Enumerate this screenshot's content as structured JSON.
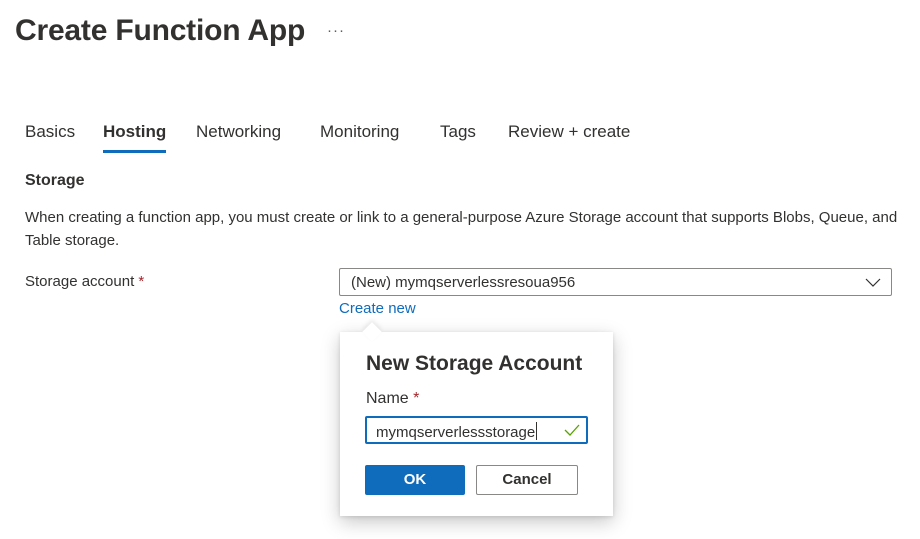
{
  "header": {
    "title": "Create Function App",
    "more_label": "···"
  },
  "tabs": [
    {
      "label": "Basics",
      "active": false
    },
    {
      "label": "Hosting",
      "active": true
    },
    {
      "label": "Networking",
      "active": false
    },
    {
      "label": "Monitoring",
      "active": false
    },
    {
      "label": "Tags",
      "active": false
    },
    {
      "label": "Review + create",
      "active": false
    }
  ],
  "storage": {
    "section_title": "Storage",
    "description": "When creating a function app, you must create or link to a general-purpose Azure Storage account that supports Blobs, Queue, and Table storage.",
    "account_label": "Storage account",
    "required_marker": "*",
    "account_value": "(New) mymqserverlessresoua956",
    "create_new_label": "Create new"
  },
  "callout": {
    "title": "New Storage Account",
    "name_label": "Name",
    "required_marker": "*",
    "name_value": "mymqserverlessstorage",
    "validation_icon": "checkmark-icon",
    "ok_label": "OK",
    "cancel_label": "Cancel"
  },
  "colors": {
    "accent": "#0f6cbd",
    "required": "#a4262c",
    "valid": "#57a300"
  }
}
